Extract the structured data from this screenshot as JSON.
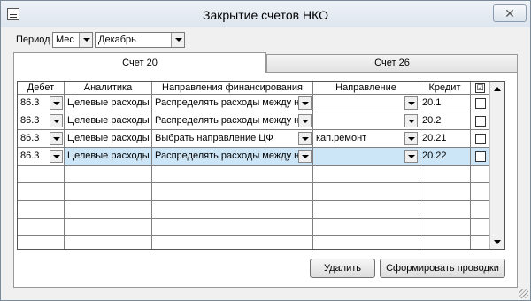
{
  "window": {
    "title": "Закрытие счетов НКО",
    "close_label": "✕"
  },
  "period": {
    "label": "Период",
    "unit_value": "Мес",
    "month_value": "Декабрь"
  },
  "tabs": [
    {
      "label": "Счет 20"
    },
    {
      "label": "Счет 26"
    }
  ],
  "table": {
    "headers": {
      "debet": "Дебет",
      "analytics": "Аналитика",
      "funding": "Направления финансирования",
      "direction": "Направление",
      "credit": "Кредит",
      "check": "☑"
    },
    "rows": [
      {
        "debet": "86.3",
        "analytics": "Целевые расходы",
        "funding": "Распределять расходы между нап",
        "direction": "",
        "credit": "20.1"
      },
      {
        "debet": "86.3",
        "analytics": "Целевые расходы",
        "funding": "Распределять расходы между нап",
        "direction": "",
        "credit": "20.2"
      },
      {
        "debet": "86.3",
        "analytics": "Целевые расходы",
        "funding": "Выбрать направление ЦФ",
        "direction": "кап.ремонт",
        "credit": "20.21"
      },
      {
        "debet": "86.3",
        "analytics": "Целевые расходы",
        "funding": "Распределять расходы между нап",
        "direction": "",
        "credit": "20.22"
      }
    ]
  },
  "buttons": {
    "delete": "Удалить",
    "generate": "Сформировать проводки"
  },
  "colors": {
    "selected_row": "#cde6f7",
    "window_bg": "#f0f0f0"
  }
}
